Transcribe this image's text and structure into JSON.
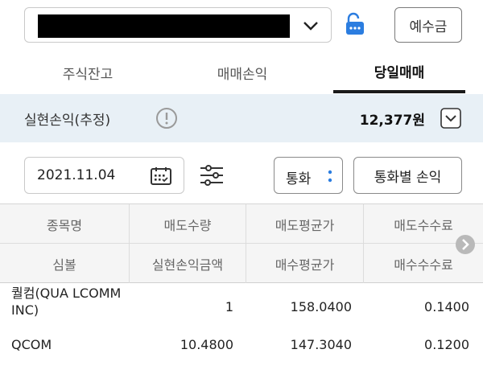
{
  "colors": {
    "summary_bg": "#e8f0f6",
    "accent_blue": "#2b7de0",
    "active_tab_underline": "#1a1a1a"
  },
  "account": {
    "value": "",
    "icon": "chevron-down-icon"
  },
  "lock": {
    "icon": "unlock-icon"
  },
  "deposit_button": {
    "label": "예수금"
  },
  "tabs": [
    {
      "label": "주식잔고",
      "active": false
    },
    {
      "label": "매매손익",
      "active": false
    },
    {
      "label": "당일매매",
      "active": true
    }
  ],
  "summary": {
    "label": "실현손익(추정)",
    "value": "12,377원",
    "info_icon": "info-icon",
    "expand_icon": "chevron-down-icon"
  },
  "filters": {
    "date": "2021.11.04",
    "calendar_icon": "calendar-icon",
    "settings_icon": "sliders-icon",
    "currency": "통화",
    "currency_pl_button": "통화별 손익"
  },
  "table": {
    "header_row1": [
      "종목명",
      "매도수량",
      "매도평균가",
      "매도수수료"
    ],
    "header_row2": [
      "심볼",
      "실현손익금액",
      "매수평균가",
      "매수수수료"
    ],
    "rows": [
      {
        "name": "퀄컴(QUA LCOMM INC)",
        "symbol": "QCOM",
        "sell_qty": "1",
        "realized_pl": "10.4800",
        "sell_avg": "158.0400",
        "buy_avg": "147.3040",
        "sell_fee": "0.1400",
        "buy_fee": "0.1200"
      }
    ]
  }
}
